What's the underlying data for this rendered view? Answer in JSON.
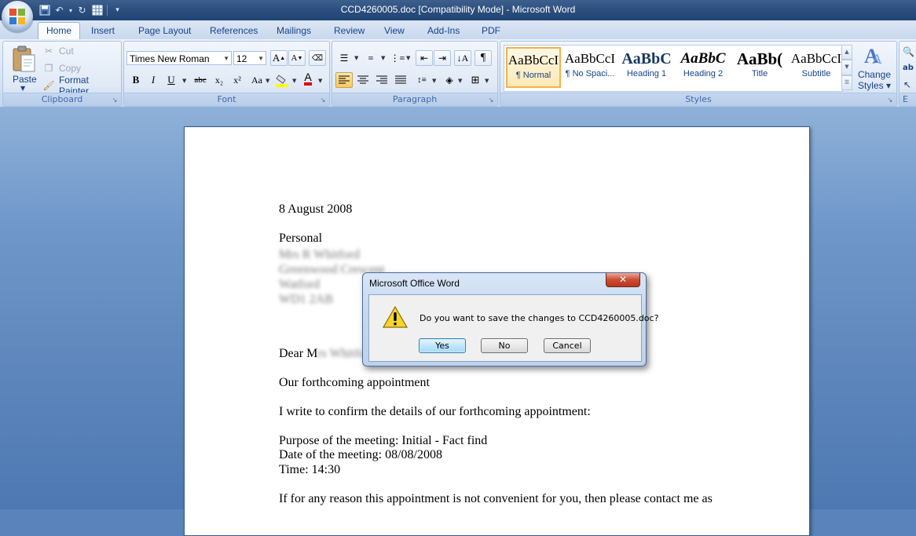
{
  "window": {
    "title": "CCD4260005.doc [Compatibility Mode] - Microsoft Word"
  },
  "ribbon": {
    "tabs": [
      "Home",
      "Insert",
      "Page Layout",
      "References",
      "Mailings",
      "Review",
      "View",
      "Add-Ins",
      "PDF"
    ],
    "active_tab": "Home",
    "clipboard": {
      "label": "Clipboard",
      "paste": "Paste",
      "cut": "Cut",
      "copy": "Copy",
      "format_painter": "Format Painter"
    },
    "font": {
      "label": "Font",
      "name": "Times New Roman",
      "size": "12",
      "bold": "B",
      "italic": "I",
      "underline": "U",
      "strike": "abc",
      "subscript": "x₂",
      "superscript": "x²",
      "change_case": "Aa"
    },
    "paragraph": {
      "label": "Paragraph"
    },
    "styles": {
      "label": "Styles",
      "items": [
        {
          "sample": "AaBbCcI",
          "name": "¶ Normal"
        },
        {
          "sample": "AaBbCcI",
          "name": "¶ No Spaci..."
        },
        {
          "sample": "AaBbC",
          "name": "Heading 1"
        },
        {
          "sample": "AaBbC",
          "name": "Heading 2"
        },
        {
          "sample": "AaBb(",
          "name": "Title"
        },
        {
          "sample": "AaBbCcI",
          "name": "Subtitle"
        }
      ],
      "change_styles_line1": "Change",
      "change_styles_line2": "Styles"
    },
    "editing_partial": "E"
  },
  "document": {
    "date": "8 August 2008",
    "personal": "Personal",
    "address_lines": [
      "Mrs R Whitford",
      "Greenwood Crescent",
      "Watford",
      "WD1 2AB"
    ],
    "salutation_prefix": "Dear M",
    "salutation_blurred": "rs Whitford",
    "subject": "Our forthcoming appointment",
    "intro": "I write to confirm the details of our forthcoming appointment:",
    "purpose": "Purpose of the meeting: Initial - Fact find",
    "meeting_date": "Date of the meeting:  08/08/2008",
    "time": "Time: 14:30",
    "closing": "If for any reason this appointment is not convenient for you, then please contact me as"
  },
  "dialog": {
    "title": "Microsoft Office Word",
    "message": "Do you want to save the changes to CCD4260005.doc?",
    "buttons": {
      "yes": "Yes",
      "no": "No",
      "cancel": "Cancel"
    },
    "close": "✕"
  }
}
